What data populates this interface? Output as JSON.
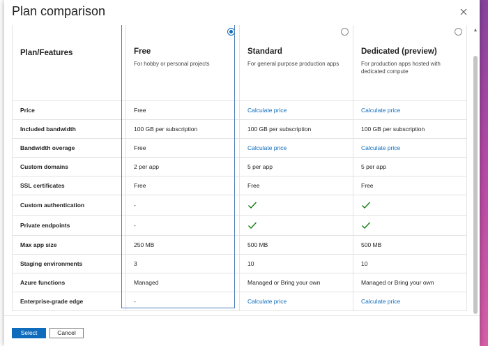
{
  "dialog": {
    "title": "Plan comparison",
    "close_label": "Close"
  },
  "table": {
    "header_feature": "Plan/Features",
    "plans": [
      {
        "name": "Free",
        "description": "For hobby or personal projects",
        "selected": true
      },
      {
        "name": "Standard",
        "description": "For general purpose production apps",
        "selected": false
      },
      {
        "name": "Dedicated (preview)",
        "description": "For production apps hosted with dedicated compute",
        "selected": false
      }
    ],
    "rows": [
      {
        "feature": "Price",
        "values": [
          {
            "text": "Free",
            "type": "text"
          },
          {
            "text": "Calculate price",
            "type": "link"
          },
          {
            "text": "Calculate price",
            "type": "link"
          }
        ]
      },
      {
        "feature": "Included bandwidth",
        "values": [
          {
            "text": "100 GB per subscription",
            "type": "text"
          },
          {
            "text": "100 GB per subscription",
            "type": "text"
          },
          {
            "text": "100 GB per subscription",
            "type": "text"
          }
        ]
      },
      {
        "feature": "Bandwidth overage",
        "values": [
          {
            "text": "Free",
            "type": "text"
          },
          {
            "text": "Calculate price",
            "type": "link"
          },
          {
            "text": "Calculate price",
            "type": "link"
          }
        ]
      },
      {
        "feature": "Custom domains",
        "values": [
          {
            "text": "2 per app",
            "type": "text"
          },
          {
            "text": "5 per app",
            "type": "text"
          },
          {
            "text": "5 per app",
            "type": "text"
          }
        ]
      },
      {
        "feature": "SSL certificates",
        "values": [
          {
            "text": "Free",
            "type": "text"
          },
          {
            "text": "Free",
            "type": "text"
          },
          {
            "text": "Free",
            "type": "text"
          }
        ]
      },
      {
        "feature": "Custom authentication",
        "values": [
          {
            "text": "-",
            "type": "text"
          },
          {
            "text": "",
            "type": "check"
          },
          {
            "text": "",
            "type": "check"
          }
        ]
      },
      {
        "feature": "Private endpoints",
        "values": [
          {
            "text": "-",
            "type": "text"
          },
          {
            "text": "",
            "type": "check"
          },
          {
            "text": "",
            "type": "check"
          }
        ]
      },
      {
        "feature": "Max app size",
        "values": [
          {
            "text": "250 MB",
            "type": "text"
          },
          {
            "text": "500 MB",
            "type": "text"
          },
          {
            "text": "500 MB",
            "type": "text"
          }
        ]
      },
      {
        "feature": "Staging environments",
        "values": [
          {
            "text": "3",
            "type": "text"
          },
          {
            "text": "10",
            "type": "text"
          },
          {
            "text": "10",
            "type": "text"
          }
        ]
      },
      {
        "feature": "Azure functions",
        "values": [
          {
            "text": "Managed",
            "type": "text"
          },
          {
            "text": "Managed or Bring your own",
            "type": "text"
          },
          {
            "text": "Managed or Bring your own",
            "type": "text"
          }
        ]
      },
      {
        "feature": "Enterprise-grade edge",
        "values": [
          {
            "text": "-",
            "type": "text"
          },
          {
            "text": "Calculate price",
            "type": "link"
          },
          {
            "text": "Calculate price",
            "type": "link"
          }
        ]
      }
    ]
  },
  "footer": {
    "select_label": "Select",
    "cancel_label": "Cancel"
  },
  "colors": {
    "accent": "#0f6cbd",
    "check": "#107c10",
    "selected_border": "#4a7db8"
  },
  "icons": {
    "close": "close-icon",
    "check": "checkmark-icon",
    "radio": "radio-button-icon"
  }
}
